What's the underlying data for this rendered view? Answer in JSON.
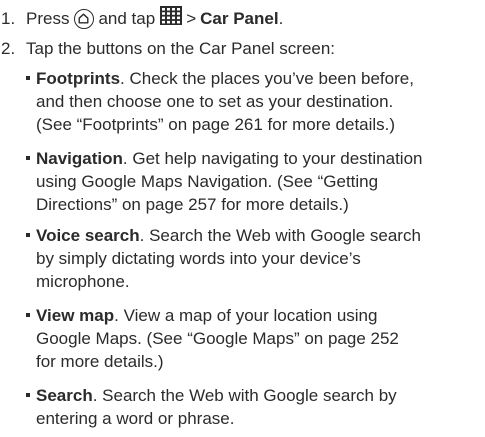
{
  "steps": [
    {
      "number": "1.",
      "text_press": "Press",
      "text_and_tap": "and tap",
      "text_arrow": ">",
      "target": "Car Panel",
      "text_period": "."
    },
    {
      "number": "2.",
      "text": "Tap the buttons on the Car Panel screen:"
    }
  ],
  "bullets": [
    {
      "title": "Footprints",
      "lines": [
        ". Check the places you’ve been before,",
        "and then choose one to set as your destination.",
        "(See “Footprints” on page 261 for more details.)"
      ]
    },
    {
      "title": "Navigation",
      "lines": [
        ". Get help navigating to your destination",
        "using Google Maps Navigation. (See “Getting",
        "Directions” on page 257 for more details.)"
      ]
    },
    {
      "title": "Voice search",
      "lines": [
        ". Search the Web with Google search",
        "by simply dictating words into your device’s",
        "microphone."
      ]
    },
    {
      "title": "View map",
      "lines": [
        ". View a map of your location using",
        "Google Maps. (See “Google Maps” on page 252",
        "for more details.)"
      ]
    },
    {
      "title": "Search",
      "lines": [
        ". Search the Web with Google search by",
        "entering a word or phrase."
      ]
    }
  ],
  "icons": {
    "home": "home-icon",
    "apps": "all-apps-grid-icon"
  }
}
